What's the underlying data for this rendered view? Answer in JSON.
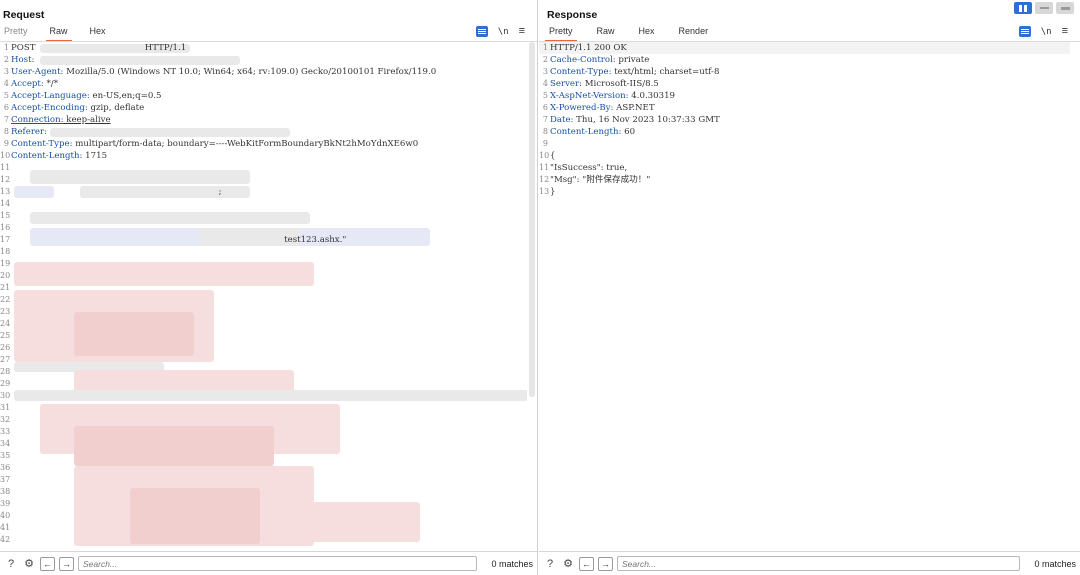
{
  "layout_toggles": [
    "split-horizontal-icon",
    "split-vertical-icon",
    "tabs-icon"
  ],
  "request": {
    "title": "Request",
    "tabs": [
      {
        "label": "Pretty",
        "active": false
      },
      {
        "label": "Raw",
        "active": true
      },
      {
        "label": "Hex",
        "active": false
      }
    ],
    "tools": {
      "newline": "\\n",
      "menu": "≡"
    },
    "lines": [
      {
        "n": "1",
        "key": "",
        "val": "POST                                        HTTP/1.1"
      },
      {
        "n": "2",
        "key": "Host:",
        "val": ""
      },
      {
        "n": "3",
        "key": "User-Agent:",
        "val": " Mozilla/5.0 (Windows NT 10.0; Win64; x64; rv:109.0) Gecko/20100101 Firefox/119.0"
      },
      {
        "n": "4",
        "key": "Accept:",
        "val": " */*"
      },
      {
        "n": "5",
        "key": "Accept-Language:",
        "val": " en-US,en;q=0.5"
      },
      {
        "n": "6",
        "key": "Accept-Encoding:",
        "val": " gzip, deflate"
      },
      {
        "n": "7",
        "key": "Connection:",
        "val": " keep-alive"
      },
      {
        "n": "8",
        "key": "Referer:",
        "val": ""
      },
      {
        "n": "9",
        "key": "Content-Type:",
        "val": " multipart/form-data; boundary=----WebKitFormBoundaryBkNt2hMoYdnXE6w0"
      },
      {
        "n": "10",
        "key": "Content-Length:",
        "val": " 1715"
      },
      {
        "n": "11",
        "key": "",
        "val": ""
      },
      {
        "n": "12",
        "key": "",
        "val": ""
      },
      {
        "n": "13",
        "key": "",
        "val": "                                                                            ;"
      },
      {
        "n": "14",
        "key": "",
        "val": ""
      },
      {
        "n": "15",
        "key": "",
        "val": ""
      },
      {
        "n": "16",
        "key": "",
        "val": ""
      },
      {
        "n": "17",
        "key": "",
        "val": "                                                                                                    test123.ashx.\""
      },
      {
        "n": "18",
        "key": "",
        "val": ""
      },
      {
        "n": "19",
        "key": "",
        "val": ""
      },
      {
        "n": "20",
        "key": "",
        "val": ""
      },
      {
        "n": "21",
        "key": "",
        "val": ""
      },
      {
        "n": "22",
        "key": "",
        "val": ""
      },
      {
        "n": "23",
        "key": "",
        "val": ""
      },
      {
        "n": "24",
        "key": "",
        "val": ""
      },
      {
        "n": "25",
        "key": "",
        "val": ""
      },
      {
        "n": "26",
        "key": "",
        "val": ""
      },
      {
        "n": "27",
        "key": "",
        "val": ""
      },
      {
        "n": "28",
        "key": "",
        "val": ""
      },
      {
        "n": "29",
        "key": "",
        "val": ""
      },
      {
        "n": "30",
        "key": "",
        "val": ""
      },
      {
        "n": "31",
        "key": "",
        "val": ""
      },
      {
        "n": "32",
        "key": "",
        "val": ""
      },
      {
        "n": "33",
        "key": "",
        "val": ""
      },
      {
        "n": "34",
        "key": "",
        "val": ""
      },
      {
        "n": "35",
        "key": "",
        "val": ""
      },
      {
        "n": "36",
        "key": "",
        "val": ""
      },
      {
        "n": "37",
        "key": "",
        "val": ""
      },
      {
        "n": "38",
        "key": "",
        "val": ""
      },
      {
        "n": "39",
        "key": "",
        "val": ""
      },
      {
        "n": "40",
        "key": "",
        "val": ""
      },
      {
        "n": "41",
        "key": "",
        "val": ""
      },
      {
        "n": "42",
        "key": "",
        "val": ""
      }
    ],
    "search_placeholder": "Search...",
    "matches": "0 matches"
  },
  "response": {
    "title": "Response",
    "tabs": [
      {
        "label": "Pretty",
        "active": true
      },
      {
        "label": "Raw",
        "active": false
      },
      {
        "label": "Hex",
        "active": false
      },
      {
        "label": "Render",
        "active": false
      }
    ],
    "tools": {
      "newline": "\\n",
      "menu": "≡"
    },
    "lines": [
      {
        "n": "1",
        "key": "",
        "val": "HTTP/1.1 200 OK"
      },
      {
        "n": "2",
        "key": "Cache-Control:",
        "val": " private"
      },
      {
        "n": "3",
        "key": "Content-Type:",
        "val": " text/html; charset=utf-8"
      },
      {
        "n": "4",
        "key": "Server:",
        "val": " Microsoft-IIS/8.5"
      },
      {
        "n": "5",
        "key": "X-AspNet-Version:",
        "val": " 4.0.30319"
      },
      {
        "n": "6",
        "key": "X-Powered-By:",
        "val": " ASP.NET"
      },
      {
        "n": "7",
        "key": "Date:",
        "val": " Thu, 16 Nov 2023 10:37:33 GMT"
      },
      {
        "n": "8",
        "key": "Content-Length:",
        "val": " 60"
      },
      {
        "n": "9",
        "key": "",
        "val": ""
      },
      {
        "n": "10",
        "key": "",
        "val": "{"
      },
      {
        "n": "11",
        "key": "",
        "val": "\"IsSuccess\": true,"
      },
      {
        "n": "12",
        "key": "",
        "val": "\"Msg\": \"附件保存成功！\""
      },
      {
        "n": "13",
        "key": "",
        "val": "}"
      }
    ],
    "search_placeholder": "Search...",
    "matches": "0 matches"
  },
  "colors": {
    "accent": "#e8643a",
    "header_key": "#1a4fa3",
    "button_blue": "#2f6fd1"
  }
}
